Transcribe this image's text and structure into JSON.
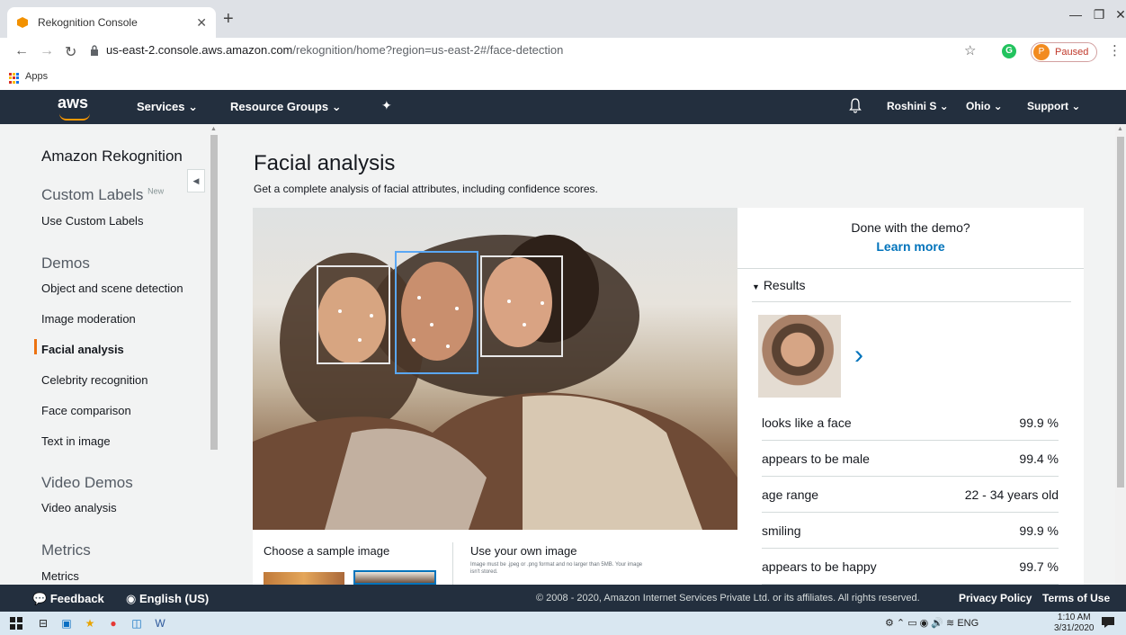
{
  "browser": {
    "tab_title": "Rekognition Console",
    "new_tab": "+",
    "url_host": "us-east-2.console.aws.amazon.com",
    "url_path": "/rekognition/home?region=us-east-2#/face-detection",
    "profile_initial": "P",
    "profile_status": "Paused",
    "bookmarks_apps": "Apps",
    "extension_letter": "G"
  },
  "awsnav": {
    "logo": "aws",
    "services": "Services ⌄",
    "resource_groups": "Resource Groups ⌄",
    "user": "Roshini S ⌄",
    "region": "Ohio ⌄",
    "support": "Support ⌄"
  },
  "sidebar": {
    "title": "Amazon Rekognition",
    "custom_labels_heading": "Custom Labels",
    "new_badge": "New",
    "use_custom_labels": "Use Custom Labels",
    "demos_heading": "Demos",
    "items": [
      "Object and scene detection",
      "Image moderation",
      "Facial analysis",
      "Celebrity recognition",
      "Face comparison",
      "Text in image"
    ],
    "video_heading": "Video Demos",
    "video_analysis": "Video analysis",
    "metrics_heading": "Metrics",
    "metrics_item": "Metrics"
  },
  "main": {
    "title": "Facial analysis",
    "subtitle": "Get a complete analysis of facial attributes, including confidence scores.",
    "choose_sample": "Choose a sample image",
    "use_own": "Use your own image",
    "use_own_hint": "Image must be .jpeg or .png format and no larger than 5MB. Your image isn't stored."
  },
  "results": {
    "demo_question": "Done with the demo?",
    "learn_more": "Learn more",
    "heading": "Results",
    "rows": [
      {
        "label": "looks like a face",
        "value": "99.9 %"
      },
      {
        "label": "appears to be male",
        "value": "99.4 %"
      },
      {
        "label": "age range",
        "value": "22 - 34 years old"
      },
      {
        "label": "smiling",
        "value": "99.9 %"
      },
      {
        "label": "appears to be happy",
        "value": "99.7 %"
      }
    ]
  },
  "footer": {
    "feedback": "Feedback",
    "language": "English (US)",
    "copyright": "© 2008 - 2020, Amazon Internet Services Private Ltd. or its affiliates. All rights reserved.",
    "privacy": "Privacy Policy",
    "terms": "Terms of Use"
  },
  "taskbar": {
    "lang": "ENG",
    "time": "1:10 AM",
    "date": "3/31/2020"
  },
  "colors": {
    "aws_nav": "#232f3e",
    "aws_orange": "#ff9900",
    "link_blue": "#0073bb",
    "active_marker": "#ec7211"
  }
}
